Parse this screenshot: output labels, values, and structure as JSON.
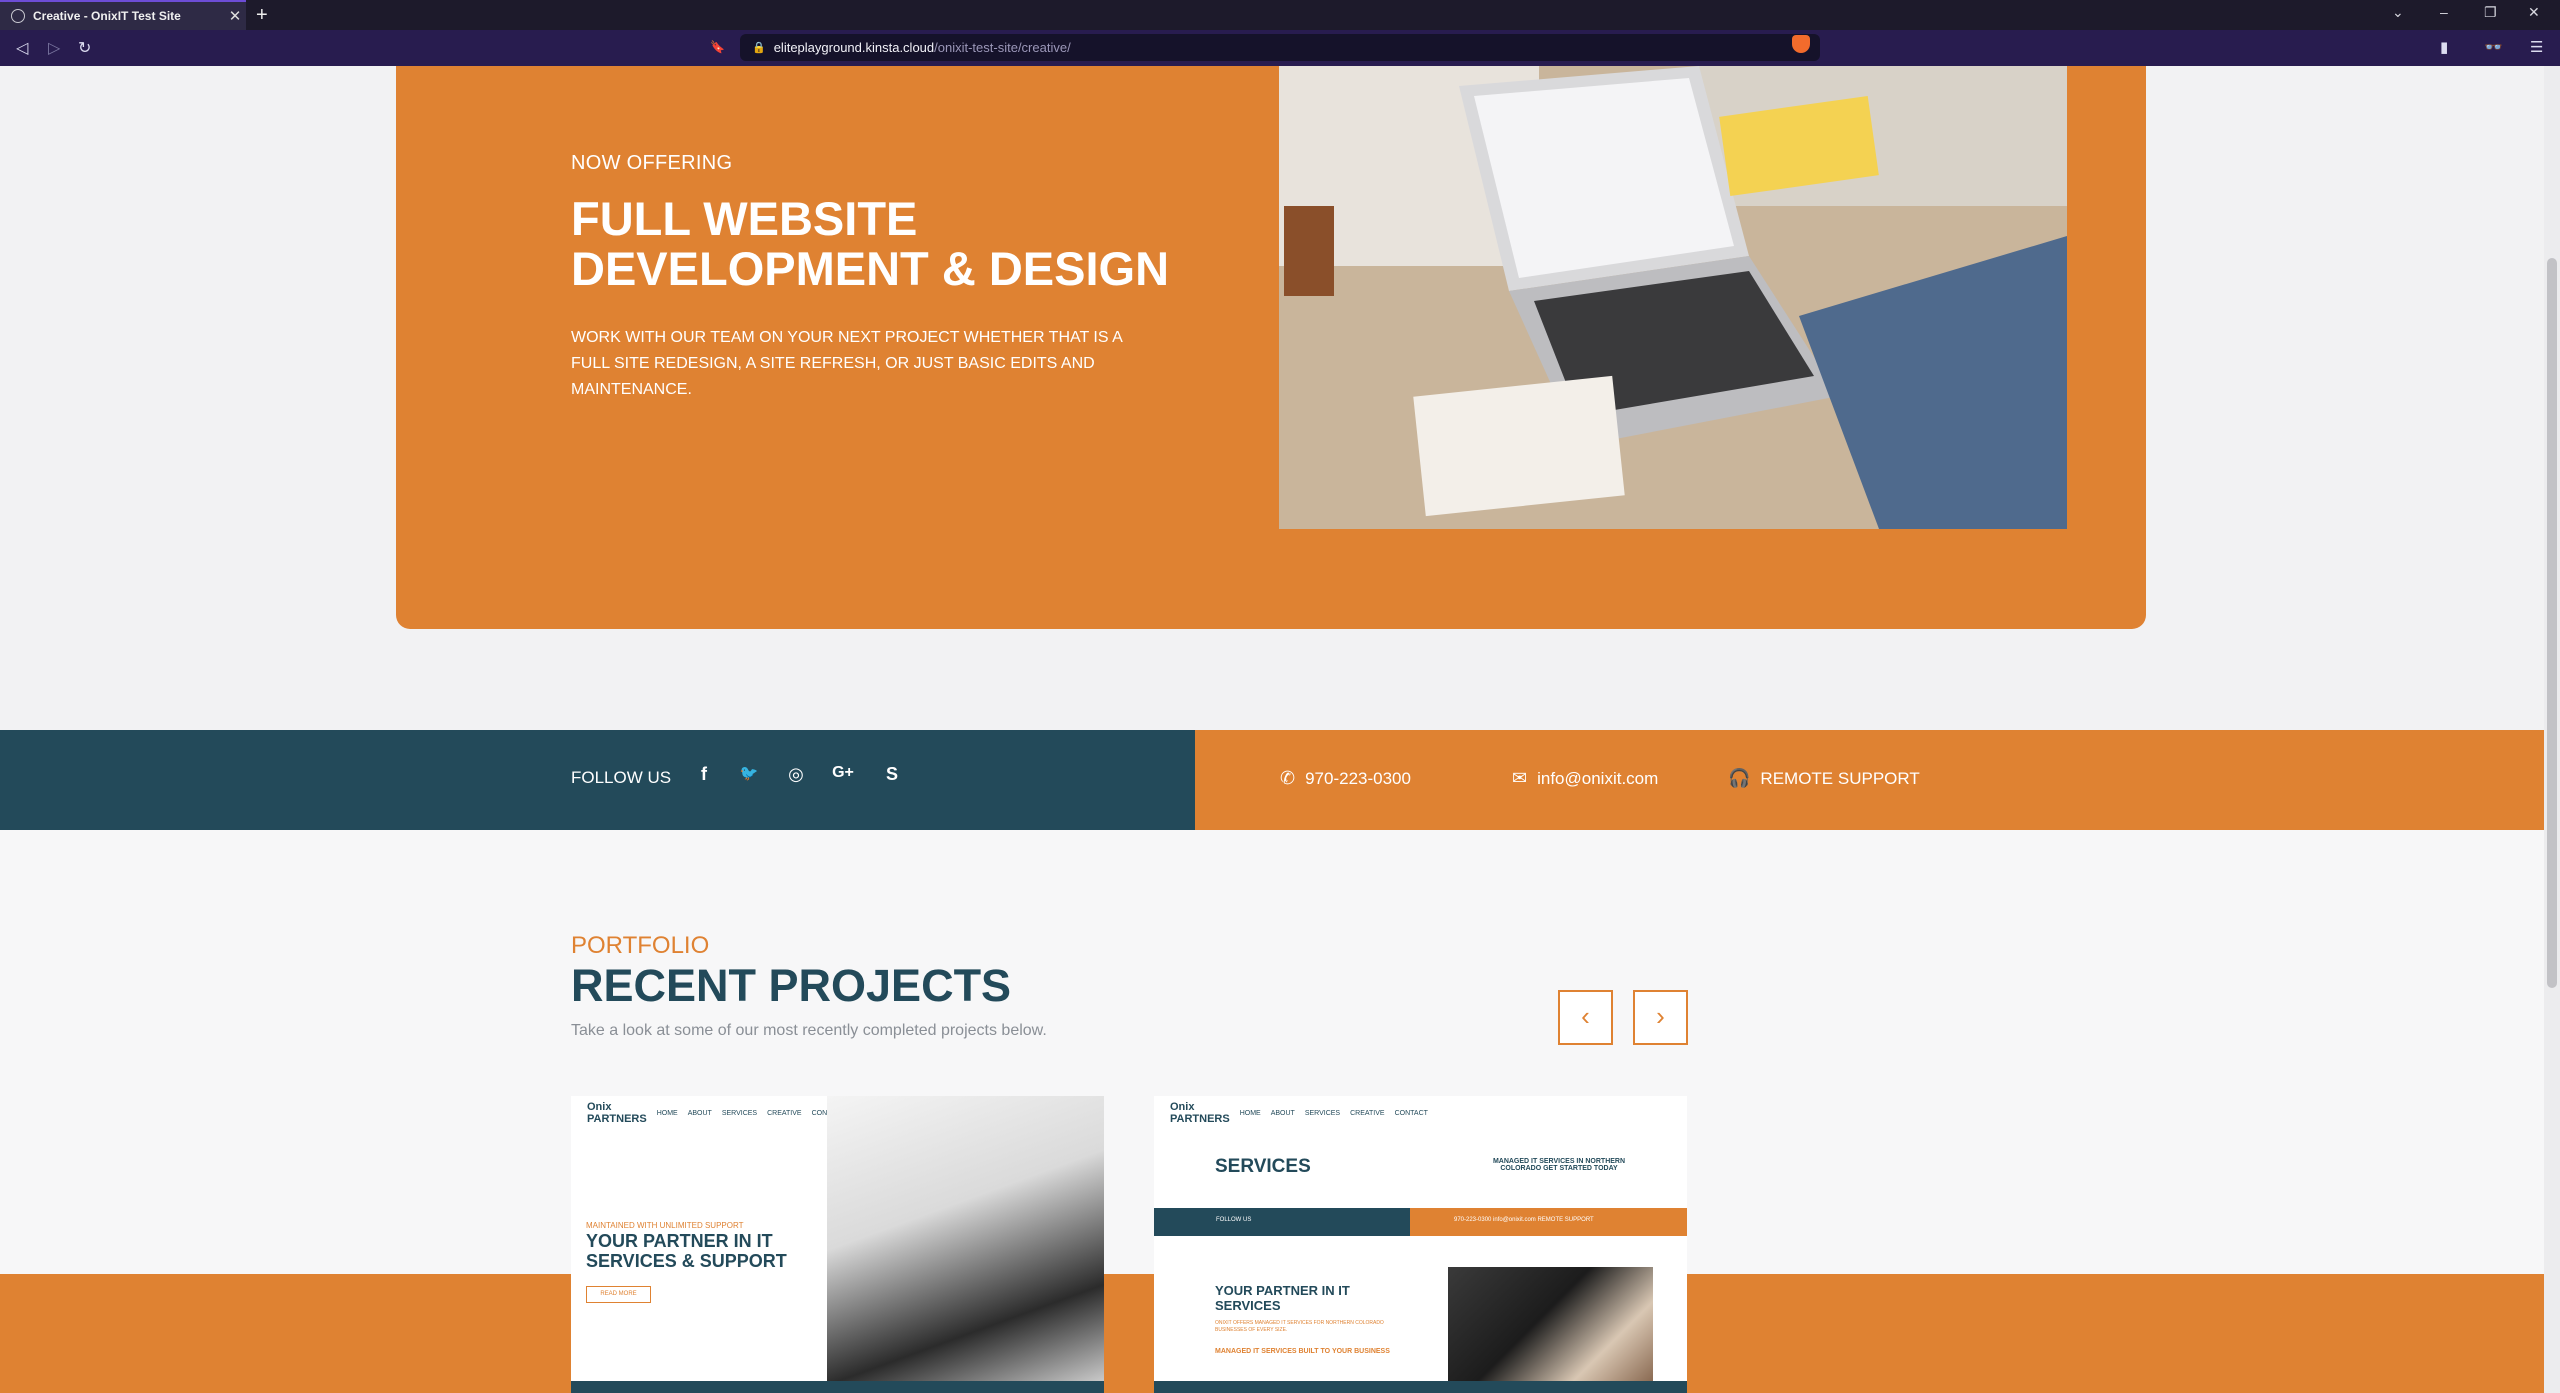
{
  "browser": {
    "tab_title": "Creative - OnixIT Test Site",
    "tab_close": "✕",
    "new_tab": "+",
    "url_host": "eliteplayground.kinsta.cloud",
    "url_path": "/onixit-test-site/creative/",
    "back": "◁",
    "forward": "▷",
    "reload": "↻",
    "bookmark": "🔖",
    "window_buttons": {
      "dropdown": "⌄",
      "minimize": "–",
      "restore": "❐",
      "close": "✕"
    },
    "sidebar_icon": "▮",
    "glasses_icon": "👓",
    "menu_icon": "☰"
  },
  "hero": {
    "kicker": "NOW OFFERING",
    "title": "FULL WEBSITE DEVELOPMENT & DESIGN",
    "description": "WORK WITH OUR TEAM ON YOUR NEXT PROJECT WHETHER THAT IS A FULL SITE REDESIGN, A SITE REFRESH, OR JUST BASIC EDITS AND MAINTENANCE."
  },
  "social_bar": {
    "follow_label": "FOLLOW US",
    "icons": [
      "facebook-icon",
      "twitter-icon",
      "instagram-icon",
      "google-plus-icon",
      "skype-icon"
    ],
    "icon_glyphs": {
      "facebook": "f",
      "twitter": "🐦",
      "instagram": "◎",
      "google_plus": "G+",
      "skype": "S"
    },
    "phone": "970-223-0300",
    "email": "info@onixit.com",
    "remote": "REMOTE SUPPORT",
    "contact_glyphs": {
      "phone": "✆",
      "email": "✉",
      "remote": "🎧"
    }
  },
  "portfolio": {
    "kicker": "PORTFOLIO",
    "title": "RECENT PROJECTS",
    "subtitle": "Take a look at some of our most recently completed projects below.",
    "prev": "‹",
    "next": "›",
    "cards": [
      {
        "logo": "Onix PARTNERS",
        "nav": [
          "HOME",
          "ABOUT",
          "SERVICES",
          "CREATIVE",
          "CONTACT"
        ],
        "kicker": "MAINTAINED WITH UNLIMITED SUPPORT",
        "title": "YOUR PARTNER IN IT SERVICES & SUPPORT",
        "button": "READ MORE"
      },
      {
        "logo": "Onix PARTNERS",
        "nav": [
          "HOME",
          "ABOUT",
          "SERVICES",
          "CREATIVE",
          "CONTACT"
        ],
        "title": "SERVICES",
        "tagline": "MANAGED IT SERVICES IN NORTHERN COLORADO GET STARTED TODAY",
        "bar_left": "FOLLOW US",
        "bar_right": "970-223-0300   info@onixit.com   REMOTE SUPPORT",
        "heading": "YOUR PARTNER IN IT SERVICES",
        "paragraph": "ONIXIT OFFERS MANAGED IT SERVICES FOR NORTHERN COLORADO BUSINESSES OF EVERY SIZE.",
        "subheading": "MANAGED IT SERVICES BUILT TO YOUR BUSINESS"
      }
    ]
  }
}
